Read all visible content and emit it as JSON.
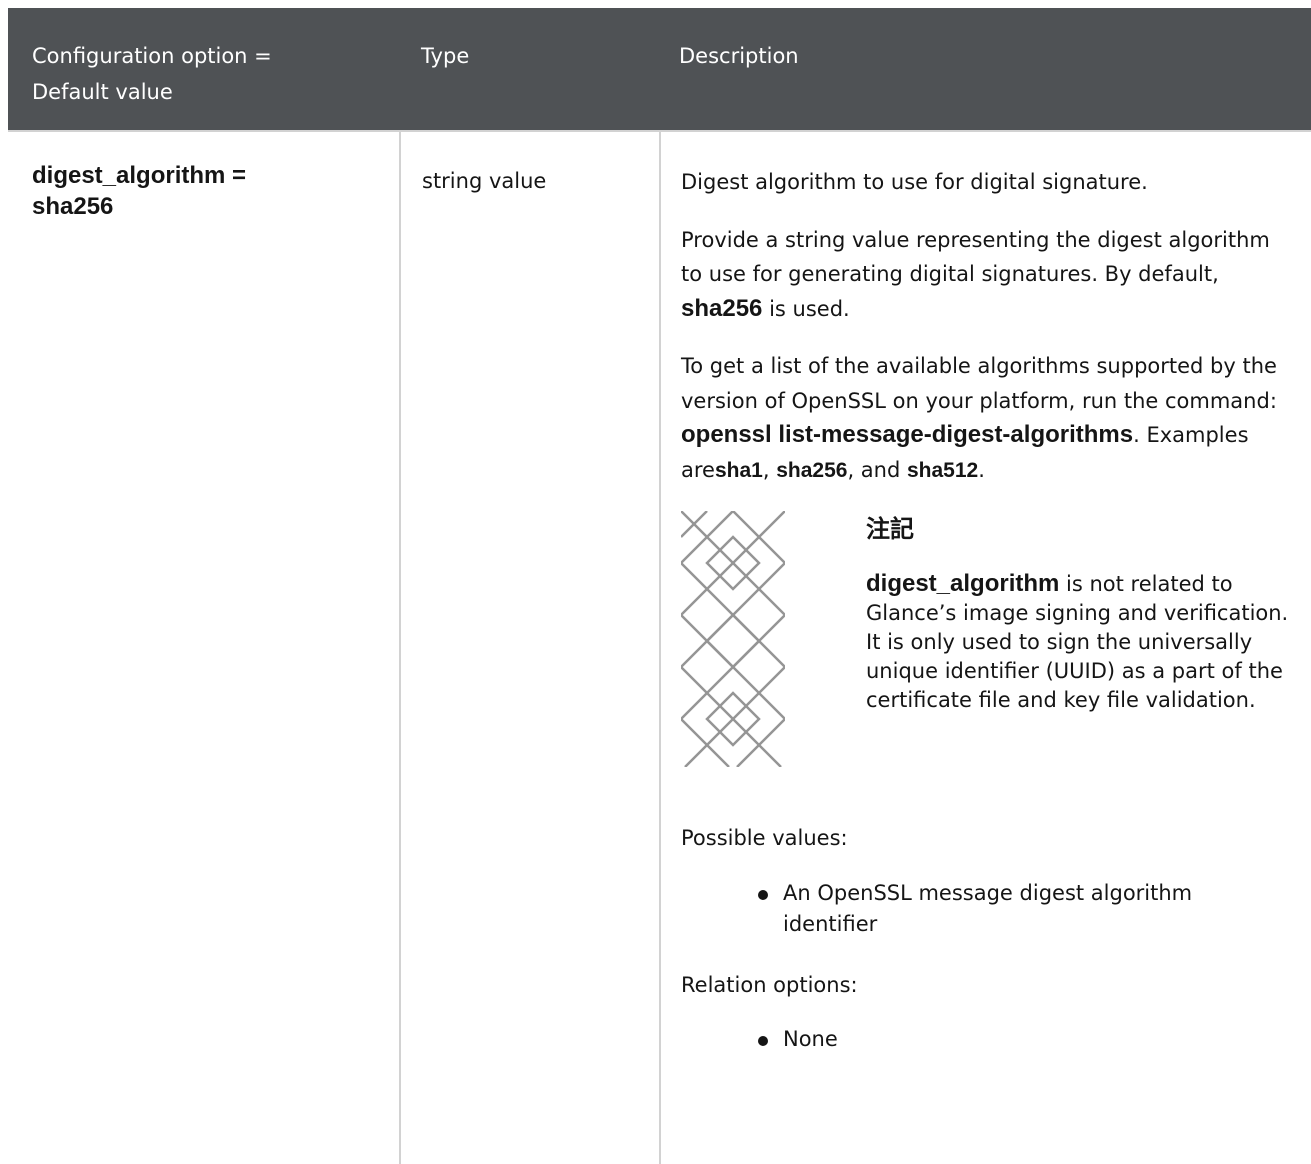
{
  "table": {
    "headers": {
      "option_line1": "Configuration option =",
      "option_line2": "Default value",
      "type": "Type",
      "description": "Description"
    },
    "row": {
      "option_name": "digest_algorithm =",
      "option_value": "sha256",
      "type": "string value",
      "description": {
        "p1": "Digest algorithm to use for digital signature.",
        "p2_pre": "Provide a string value representing the digest algorithm to use for generating digital signatures. By default, ",
        "p2_code": "sha256",
        "p2_post": " is used.",
        "p3_pre": "To get a list of the available algorithms supported by the version of OpenSSL on your platform, run the command: ",
        "p3_code": "openssl list-message-digest-algorithms",
        "p3_mid": ". Examples are",
        "p3_ex1": "sha1",
        "p3_sep1": ", ",
        "p3_ex2": "sha256",
        "p3_sep2": ", and ",
        "p3_ex3": "sha512",
        "p3_end": ".",
        "note": {
          "title": "注記",
          "code": "digest_algorithm",
          "text": " is not related to Glance’s image signing and verification. It is only used to sign the universally unique identifier (UUID) as a part of the certificate file and key file validation."
        },
        "possible_values_label": "Possible values:",
        "possible_values": [
          "An OpenSSL message digest algorithm identifier"
        ],
        "relation_options_label": "Relation options:",
        "relation_options": [
          "None"
        ]
      }
    }
  },
  "colors": {
    "header_bg": "#4f5255",
    "header_text": "#ffffff",
    "border": "#d2d2d2",
    "text": "#151515"
  }
}
